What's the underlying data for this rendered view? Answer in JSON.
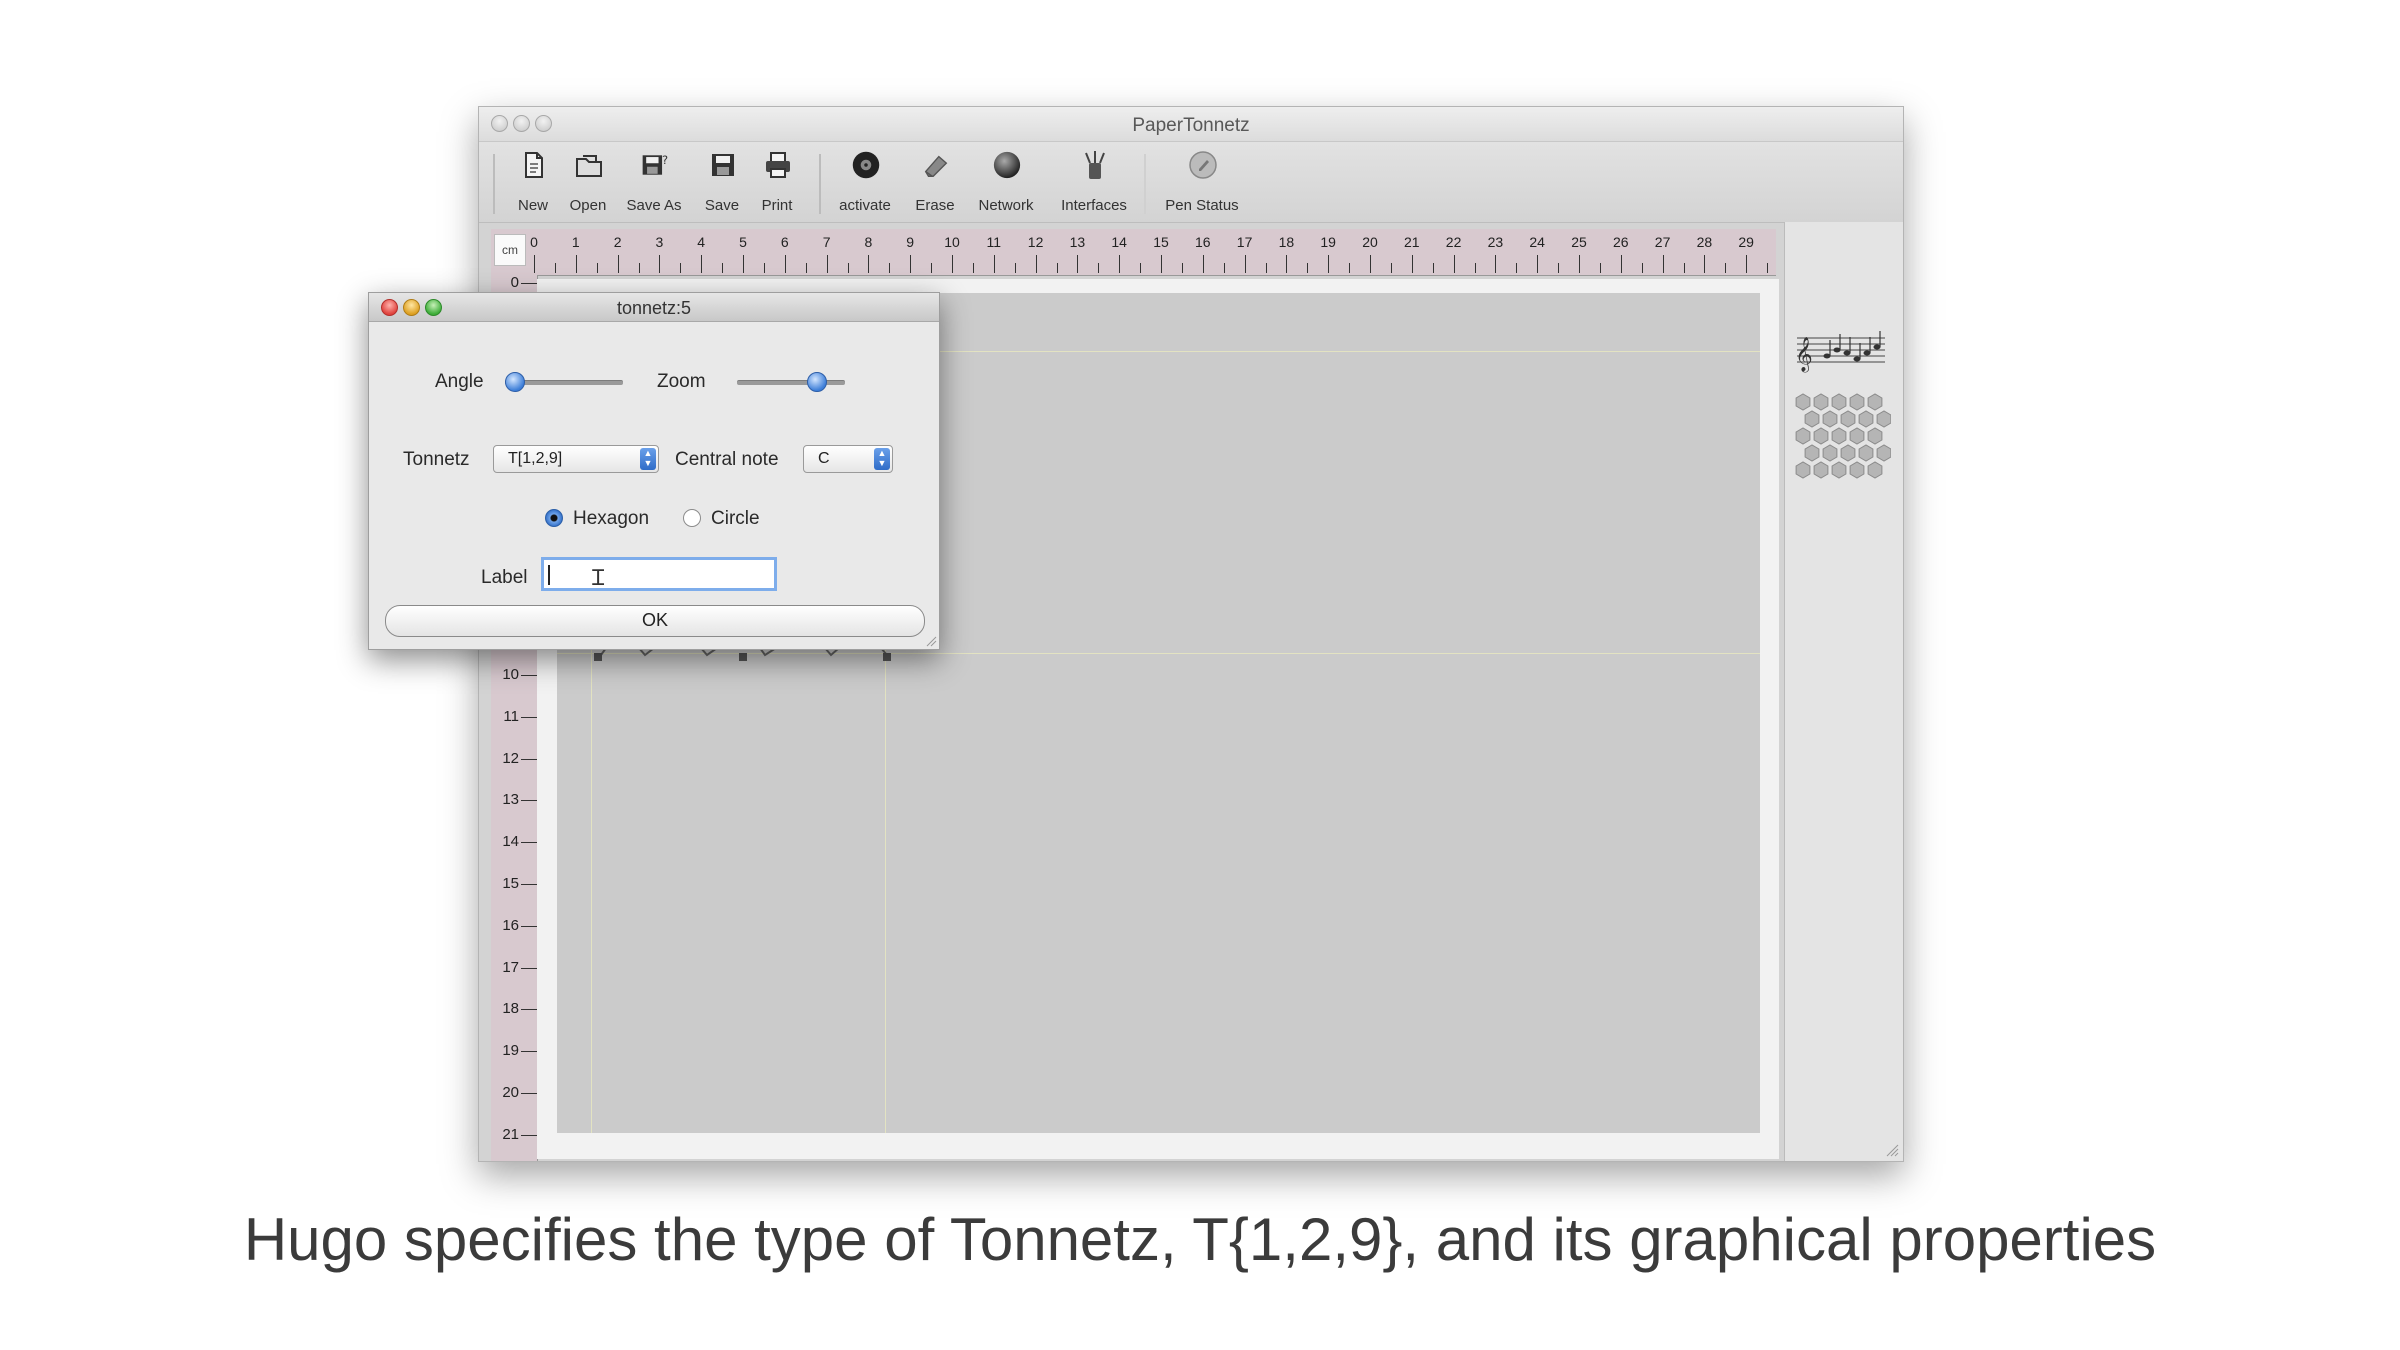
{
  "window": {
    "title": "PaperTonnetz"
  },
  "toolbar": {
    "items": [
      {
        "label": "New",
        "icon": "new-document-icon"
      },
      {
        "label": "Open",
        "icon": "open-folder-icon"
      },
      {
        "label": "Save As",
        "icon": "save-as-icon"
      },
      {
        "label": "Save",
        "icon": "save-icon"
      },
      {
        "label": "Print",
        "icon": "print-icon"
      },
      {
        "label": "activate",
        "icon": "activate-disc-icon"
      },
      {
        "label": "Erase",
        "icon": "eraser-icon"
      },
      {
        "label": "Network",
        "icon": "network-sphere-icon"
      },
      {
        "label": "Interfaces",
        "icon": "interfaces-icon"
      },
      {
        "label": "Pen Status",
        "icon": "pen-status-icon"
      }
    ]
  },
  "ruler": {
    "unit": "cm",
    "horizontal": [
      "0",
      "1",
      "2",
      "3",
      "4",
      "5",
      "6",
      "7",
      "8",
      "9",
      "10",
      "11",
      "12",
      "13",
      "14",
      "15",
      "16",
      "17",
      "18",
      "19",
      "20",
      "21",
      "22",
      "23",
      "24",
      "25",
      "26",
      "27",
      "28",
      "29"
    ],
    "vertical": [
      "0",
      "10",
      "11",
      "12",
      "13",
      "14",
      "15",
      "16",
      "17",
      "18",
      "19",
      "20",
      "21"
    ]
  },
  "dialog": {
    "title": "tonnetz:5",
    "angle_label": "Angle",
    "angle_value": 0.0,
    "zoom_label": "Zoom",
    "zoom_value": 0.8,
    "tonnetz_label": "Tonnetz",
    "tonnetz_value": "T[1,2,9]",
    "central_note_label": "Central note",
    "central_note_value": "C",
    "shape_options": [
      {
        "label": "Hexagon",
        "selected": true
      },
      {
        "label": "Circle",
        "selected": false
      }
    ],
    "label_field_label": "Label",
    "label_value": "",
    "ok_label": "OK"
  },
  "caption": "Hugo specifies the type of Tonnetz, T{1,2,9}, and its graphical properties",
  "colors": {
    "ruler_bg": "#d8c9cf",
    "canvas_bg": "#cbcbcb",
    "accent_blue": "#3d7ed8",
    "close_red": "#e0443e",
    "minimize_yellow": "#dea123",
    "zoom_green": "#3fae3a"
  }
}
